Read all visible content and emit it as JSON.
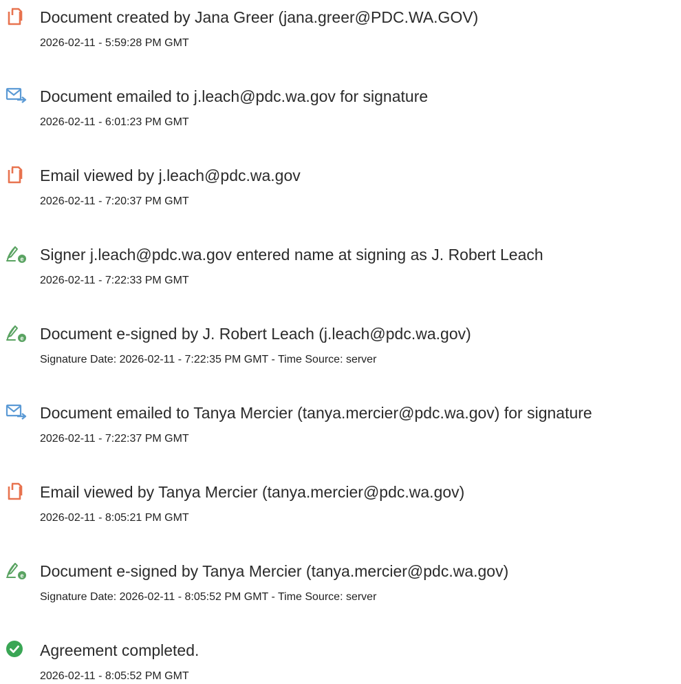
{
  "colors": {
    "document_icon": "#e8734f",
    "email_icon": "#5b9ad5",
    "sign_icon": "#5aa362",
    "complete_icon": "#3aa655",
    "text": "#2b2b2b"
  },
  "events": [
    {
      "icon": "document-icon",
      "title": "Document created by Jana Greer (jana.greer@PDC.WA.GOV)",
      "detail": "2026-02-11 - 5:59:28 PM GMT"
    },
    {
      "icon": "email-icon",
      "title": "Document emailed to j.leach@pdc.wa.gov for signature",
      "detail": "2026-02-11 - 6:01:23 PM GMT"
    },
    {
      "icon": "document-icon",
      "title": "Email viewed by j.leach@pdc.wa.gov",
      "detail": "2026-02-11 - 7:20:37 PM GMT"
    },
    {
      "icon": "signature-icon",
      "title": "Signer j.leach@pdc.wa.gov entered name at signing as J. Robert Leach",
      "detail": "2026-02-11 - 7:22:33 PM GMT"
    },
    {
      "icon": "signature-icon",
      "title": "Document e-signed by J. Robert Leach (j.leach@pdc.wa.gov)",
      "detail": "Signature Date: 2026-02-11 - 7:22:35 PM GMT - Time Source: server"
    },
    {
      "icon": "email-icon",
      "title": "Document emailed to Tanya Mercier (tanya.mercier@pdc.wa.gov) for signature",
      "detail": "2026-02-11 - 7:22:37 PM GMT"
    },
    {
      "icon": "document-icon",
      "title": "Email viewed by Tanya Mercier (tanya.mercier@pdc.wa.gov)",
      "detail": "2026-02-11 - 8:05:21 PM GMT"
    },
    {
      "icon": "signature-icon",
      "title": "Document e-signed by Tanya Mercier (tanya.mercier@pdc.wa.gov)",
      "detail": "Signature Date: 2026-02-11 - 8:05:52 PM GMT - Time Source: server"
    },
    {
      "icon": "check-circle-icon",
      "title": "Agreement completed.",
      "detail": "2026-02-11 - 8:05:52 PM GMT"
    }
  ]
}
